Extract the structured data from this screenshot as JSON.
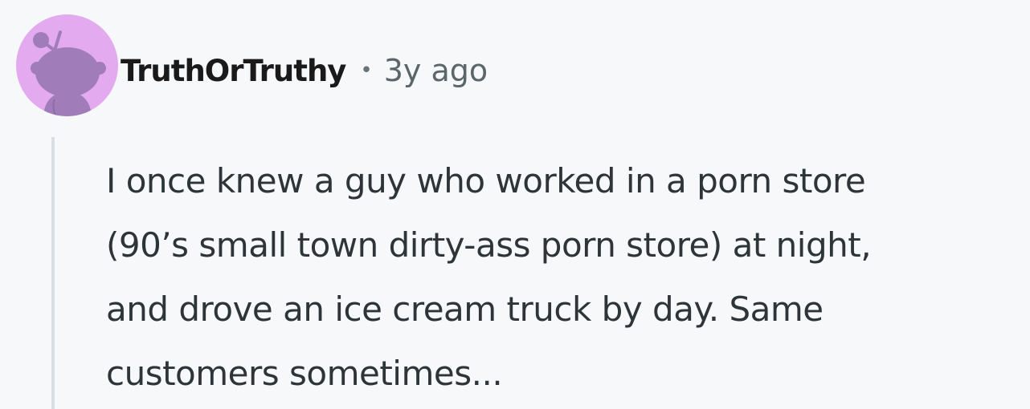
{
  "comment": {
    "username": "TruthOrTruthy",
    "separator": "•",
    "timestamp": "3y ago",
    "body_lines": [
      "I once knew a guy who worked in a porn store",
      "(90’s small town dirty-ass porn store) at night,",
      "and drove an ice cream truck by day. Same",
      "customers sometimes..."
    ]
  },
  "icons": {
    "avatar": "snoo-avatar-icon"
  },
  "colors": {
    "page_background": "#f7f8fa",
    "avatar_background": "#e3aaf0",
    "avatar_figure": "#a07cb8",
    "thread_line": "#dadfe3",
    "username": "#1a1a1b",
    "meta_text": "#5b666b",
    "body_text": "#2d3539"
  }
}
